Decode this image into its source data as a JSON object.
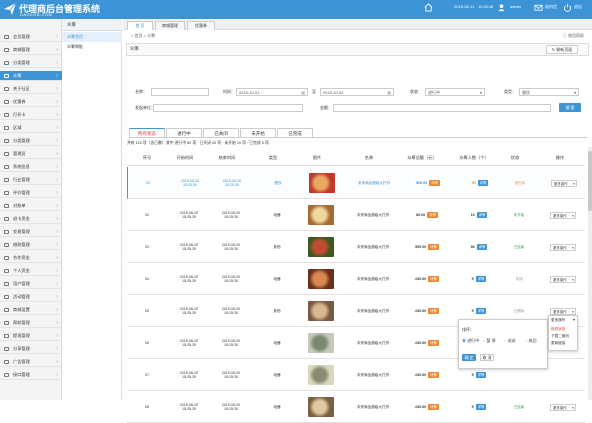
{
  "header": {
    "title": "代理商后台管理系统",
    "subtitle": "DAGERA.COM",
    "date": "2015-08-11",
    "time": "11:28:48",
    "user": "admin",
    "messages_label": "站内信",
    "logout_label": "退出"
  },
  "sidebar": {
    "items": [
      {
        "label": "会员管理"
      },
      {
        "label": "商城管理"
      },
      {
        "label": "分类管理"
      },
      {
        "label": "众筹"
      },
      {
        "label": "关于社区"
      },
      {
        "label": "优惠券"
      },
      {
        "label": "打折卡"
      },
      {
        "label": "区域"
      },
      {
        "label": "分类管理"
      },
      {
        "label": "管理员"
      },
      {
        "label": "系统信息"
      },
      {
        "label": "行业管理"
      },
      {
        "label": "评价管理"
      },
      {
        "label": "对账单"
      },
      {
        "label": "退卡资金"
      },
      {
        "label": "交易管理"
      },
      {
        "label": "借款管理"
      },
      {
        "label": "合作资金"
      },
      {
        "label": "个人资金"
      },
      {
        "label": "用户管理"
      },
      {
        "label": "活动管理"
      },
      {
        "label": "商城设置"
      },
      {
        "label": "帮助管理"
      },
      {
        "label": "提现管理"
      },
      {
        "label": "分享管理"
      },
      {
        "label": "广告管理"
      },
      {
        "label": "接口管理"
      }
    ]
  },
  "subnav": {
    "title": "众筹",
    "items": [
      {
        "label": "众筹首页"
      },
      {
        "label": "众筹审批"
      }
    ]
  },
  "tabs": [
    {
      "label": "首 页"
    },
    {
      "label": "商城管理"
    },
    {
      "label": "优惠券"
    }
  ],
  "breadcrumb": {
    "home": "首页",
    "sep1": ">",
    "current": "众筹"
  },
  "help_label": "使用帮助",
  "panel": {
    "title": "众筹",
    "refresh_label": "刷新页面"
  },
  "filters": {
    "name_label": "名称：",
    "time_label": "时间：",
    "date_from": "2015-10-01",
    "date_to_label": "至",
    "date_to": "2015-10-02",
    "status_label": "状态：",
    "status_value": "进行中",
    "type_label": "类型：",
    "type_value": "餐饮",
    "initiator_label": "发起单位：",
    "amount_label": "金额：",
    "search_label": "搜 索"
  },
  "status_tabs": [
    {
      "label": "所有状态"
    },
    {
      "label": "进行中"
    },
    {
      "label": "已关闭"
    },
    {
      "label": "未开始"
    },
    {
      "label": "已完成"
    }
  ],
  "summary": "共有 115 项（含已删）· 其中 进行中 80 项 · 已关闭 20 项 · 未开始 10 项 · 已完成 5 项",
  "table": {
    "headers": [
      "序号",
      "开始时间",
      "结束时间",
      "类型",
      "图片",
      "名称",
      "众筹总额（元）",
      "众筹人数（个）",
      "状态",
      "操作"
    ],
    "rows": [
      {
        "no": "01",
        "start": "2015-06-20\n15:25:30",
        "end": "2015-06-20\n15:25:30",
        "type": "餐饮",
        "name": "未来商品超级大打折",
        "total": "500.00",
        "people": "50",
        "status": "进行中",
        "op": "更多操作"
      },
      {
        "no": "02",
        "start": "2015-06-20\n15:25:30",
        "end": "2015-06-20\n15:25:30",
        "type": "电器",
        "name": "未来商品超级大打折",
        "total": "80.00",
        "people": "10",
        "status": "未开始",
        "op": "更多操作"
      },
      {
        "no": "03",
        "start": "2015-06-20\n15:25:30",
        "end": "2015-06-20\n15:25:30",
        "type": "其他",
        "name": "未来商品超级大打折",
        "total": "500.00",
        "people": "50",
        "status": "已结束",
        "op": "更多操作"
      },
      {
        "no": "04",
        "start": "2015-06-20\n15:25:30",
        "end": "2015-06-20\n15:25:30",
        "type": "电器",
        "name": "未来商品超级大打折",
        "total": "230.00",
        "people": "5",
        "status": "关闭",
        "op": "更多操作"
      },
      {
        "no": "05",
        "start": "2015-06-20\n15:25:30",
        "end": "2015-06-20\n15:25:30",
        "type": "其他",
        "name": "未来商品超级大打折",
        "total": "230.00",
        "people": "5",
        "status": "已删除",
        "op": "更多操作"
      },
      {
        "no": "06",
        "start": "2015-06-20\n15:25:30",
        "end": "2015-06-20\n15:25:30",
        "type": "电器",
        "name": "未来商品超级大打折",
        "total": "230.00",
        "people": "5",
        "status": "",
        "op": "更多操作"
      },
      {
        "no": "07",
        "start": "2015-06-20\n15:25:30",
        "end": "2015-06-20\n15:25:30",
        "type": "电器",
        "name": "未来商品超级大打折",
        "total": "230.00",
        "people": "5",
        "status": "",
        "op": ""
      },
      {
        "no": "08",
        "start": "2015-06-20\n15:25:30",
        "end": "2015-06-20\n15:25:30",
        "type": "电器",
        "name": "未来商品超级大打折",
        "total": "230.00",
        "people": "5",
        "status": "已结束",
        "op": "更多操作"
      }
    ],
    "details_btn": "详情"
  },
  "popup_status": {
    "title": "排序：",
    "options": [
      {
        "label": "进行中"
      },
      {
        "label": "暂 停"
      },
      {
        "label": "关闭"
      },
      {
        "label": "成功"
      }
    ],
    "confirm": "确 定",
    "cancel": "取 消"
  },
  "popup_menu": {
    "head": "更多操作",
    "items": [
      {
        "label": "修改状态"
      },
      {
        "label": "下载二维码"
      },
      {
        "label": "更新链接"
      }
    ]
  },
  "colors": {
    "accent": "#3c94d6",
    "danger": "#e03030",
    "orange": "#e8892e",
    "green": "#3aa84a"
  },
  "icons": {
    "logo": "paper-plane-icon",
    "home": "home-icon",
    "user": "user-icon",
    "mail": "mail-icon",
    "logout": "power-icon"
  }
}
